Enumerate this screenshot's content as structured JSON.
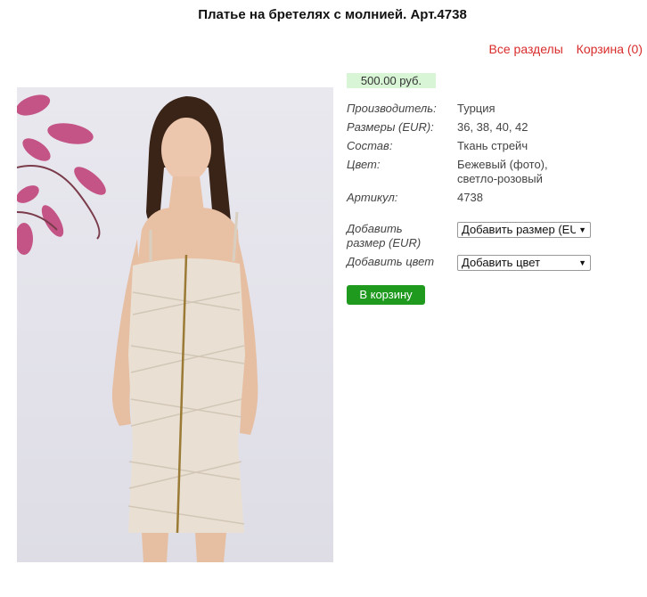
{
  "page": {
    "title": "Платье на бретелях с молнией. Арт.4738"
  },
  "nav": {
    "sections_label": "Все разделы",
    "cart_label": "Корзина (0)"
  },
  "product": {
    "price": "500.00 руб.",
    "properties": [
      {
        "key": "Производитель:",
        "value": "Турция"
      },
      {
        "key": "Размеры (EUR):",
        "value": "36, 38, 40, 42"
      },
      {
        "key": "Состав:",
        "value": "Ткань стрейч"
      },
      {
        "key": "Цвет:",
        "value_line1": "Бежевый (фото),",
        "value_line2": "светло-розовый"
      },
      {
        "key": "Артикул:",
        "value": "4738"
      }
    ],
    "add_size": {
      "label_line1": "Добавить",
      "label_line2": "размер (EUR)",
      "selected": "Добавить размер (EUR)"
    },
    "add_color": {
      "label": "Добавить цвет",
      "selected": "Добавить цвет"
    },
    "cart_button": "В корзину"
  },
  "colors": {
    "link": "#d92b2b",
    "price_bg": "#d8f5d6",
    "button": "#1f9a1f"
  },
  "icons": {
    "select_arrow": "dropdown-arrow-icon"
  }
}
